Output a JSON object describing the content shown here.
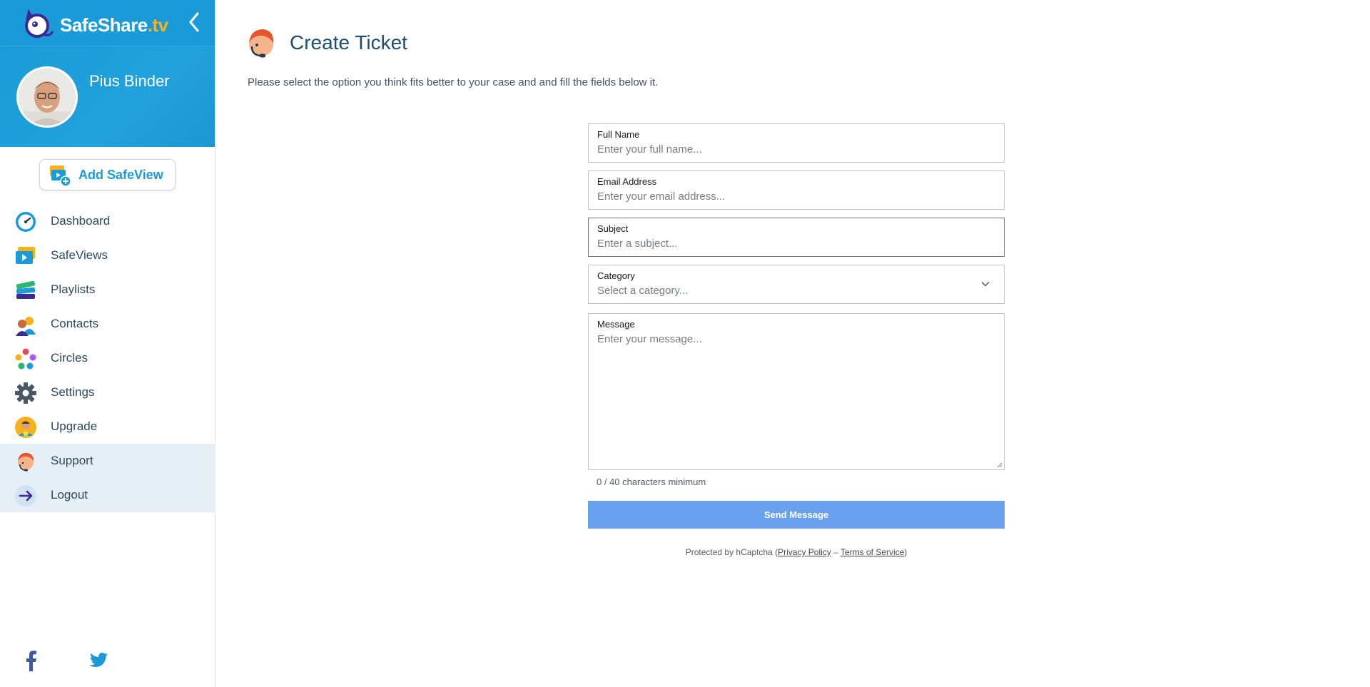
{
  "brand": {
    "name": "SafeShare",
    "tld": ".tv"
  },
  "profile": {
    "name": "Pius Binder"
  },
  "sidebar": {
    "add_button": "Add SafeView",
    "items": [
      {
        "label": "Dashboard",
        "icon": "dashboard-gauge-icon"
      },
      {
        "label": "SafeViews",
        "icon": "safeviews-icon"
      },
      {
        "label": "Playlists",
        "icon": "playlists-icon"
      },
      {
        "label": "Contacts",
        "icon": "contacts-icon"
      },
      {
        "label": "Circles",
        "icon": "circles-icon"
      },
      {
        "label": "Settings",
        "icon": "gear-icon"
      },
      {
        "label": "Upgrade",
        "icon": "upgrade-icon"
      },
      {
        "label": "Support",
        "icon": "support-agent-icon"
      },
      {
        "label": "Logout",
        "icon": "logout-arrow-icon"
      }
    ],
    "social": [
      "facebook-icon",
      "twitter-icon"
    ]
  },
  "page": {
    "title": "Create Ticket",
    "intro": "Please select the option you think fits better to your case and and fill the fields below it."
  },
  "form": {
    "full_name": {
      "label": "Full Name",
      "placeholder": "Enter your full name..."
    },
    "email": {
      "label": "Email Address",
      "placeholder": "Enter your email address..."
    },
    "subject": {
      "label": "Subject",
      "placeholder": "Enter a subject..."
    },
    "category": {
      "label": "Category",
      "placeholder": "Select a category..."
    },
    "message": {
      "label": "Message",
      "placeholder": "Enter your message..."
    },
    "char_count": "0 / 40 characters minimum",
    "submit": "Send Message",
    "captcha": {
      "prefix": "Protected by hCaptcha (",
      "privacy": "Privacy Policy",
      "sep": " – ",
      "terms": "Terms of Service",
      "suffix": ")"
    }
  },
  "colors": {
    "brand_blue": "#1a9bd7",
    "brand_orange": "#f6b21a",
    "title_blue": "#1d4d72",
    "button_blue": "#6aa1ee",
    "active_bg": "#e6eff5"
  }
}
